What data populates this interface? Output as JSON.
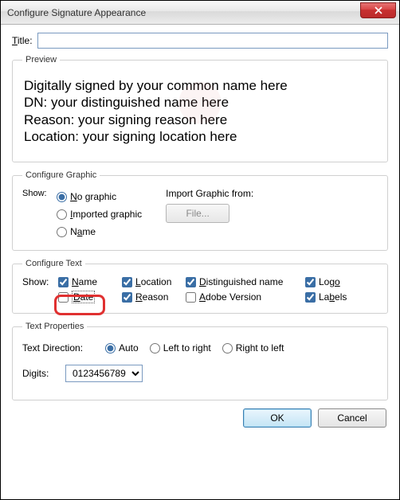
{
  "window": {
    "title": "Configure Signature Appearance"
  },
  "titleRow": {
    "label": "Title:",
    "value": ""
  },
  "preview": {
    "legend": "Preview",
    "lines": {
      "l1": "Digitally signed by your common name here",
      "l2": "DN: your distinguished name here",
      "l3": "Reason: your signing reason here",
      "l4": "Location: your signing location here"
    }
  },
  "graphic": {
    "legend": "Configure Graphic",
    "showLabel": "Show:",
    "options": {
      "noGraphic": "No graphic",
      "imported": "Imported graphic",
      "name": "Name"
    },
    "selected": "noGraphic",
    "importLabel": "Import Graphic from:",
    "fileButton": "File..."
  },
  "text": {
    "legend": "Configure Text",
    "showLabel": "Show:",
    "checks": {
      "name": {
        "label": "Name",
        "checked": true
      },
      "location": {
        "label": "Location",
        "checked": true
      },
      "dn": {
        "label": "Distinguished name",
        "checked": true
      },
      "logo": {
        "label": "Logo",
        "checked": true
      },
      "date": {
        "label": "Date",
        "checked": false
      },
      "reason": {
        "label": "Reason",
        "checked": true
      },
      "adobe": {
        "label": "Adobe Version",
        "checked": false
      },
      "labels": {
        "label": "Labels",
        "checked": true
      }
    }
  },
  "textProps": {
    "legend": "Text Properties",
    "directionLabel": "Text Direction:",
    "options": {
      "auto": "Auto",
      "ltr": "Left to right",
      "rtl": "Right to left"
    },
    "selected": "auto",
    "digitsLabel": "Digits:",
    "digitsValue": "0123456789"
  },
  "buttons": {
    "ok": "OK",
    "cancel": "Cancel"
  }
}
